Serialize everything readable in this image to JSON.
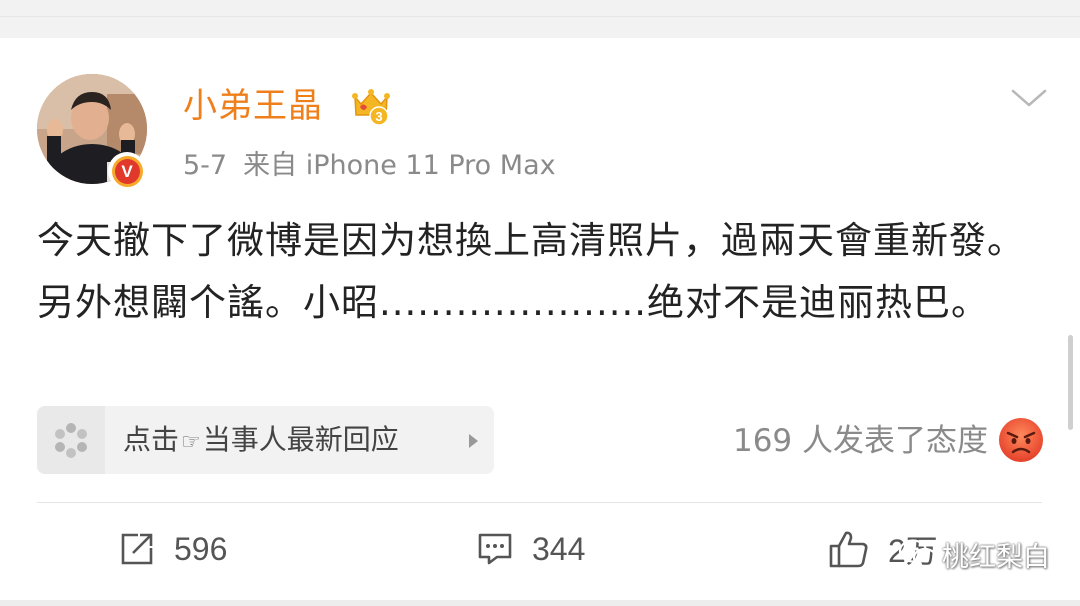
{
  "post": {
    "username": "小弟王晶",
    "date": "5-7",
    "source": "来自 iPhone 11 Pro Max",
    "text": "今天撤下了微博是因为想換上高清照片，過兩天會重新發。另外想闢个謠。小昭.....................绝对不是迪丽热巴。",
    "vip_badge_number": "3",
    "verify_badge_letter": "V"
  },
  "response_strip": {
    "label_before": "点击",
    "label_after": "当事人最新回应",
    "hand_glyph": "☞"
  },
  "attitude": {
    "text": "169 人发表了态度"
  },
  "actions": {
    "repost_count": "596",
    "comment_count": "344",
    "like_count": "2万"
  },
  "watermark": {
    "text": "桃红梨白"
  },
  "colors": {
    "username": "#ef7f1a",
    "text": "#232323",
    "meta": "#8a8a8a"
  },
  "icons": [
    "avatar",
    "verify-v-icon",
    "vip-crown-icon",
    "chevron-down-icon",
    "response-sparkle-icon",
    "angry-face-icon",
    "repost-icon",
    "comment-icon",
    "like-icon",
    "wechat-icon"
  ]
}
